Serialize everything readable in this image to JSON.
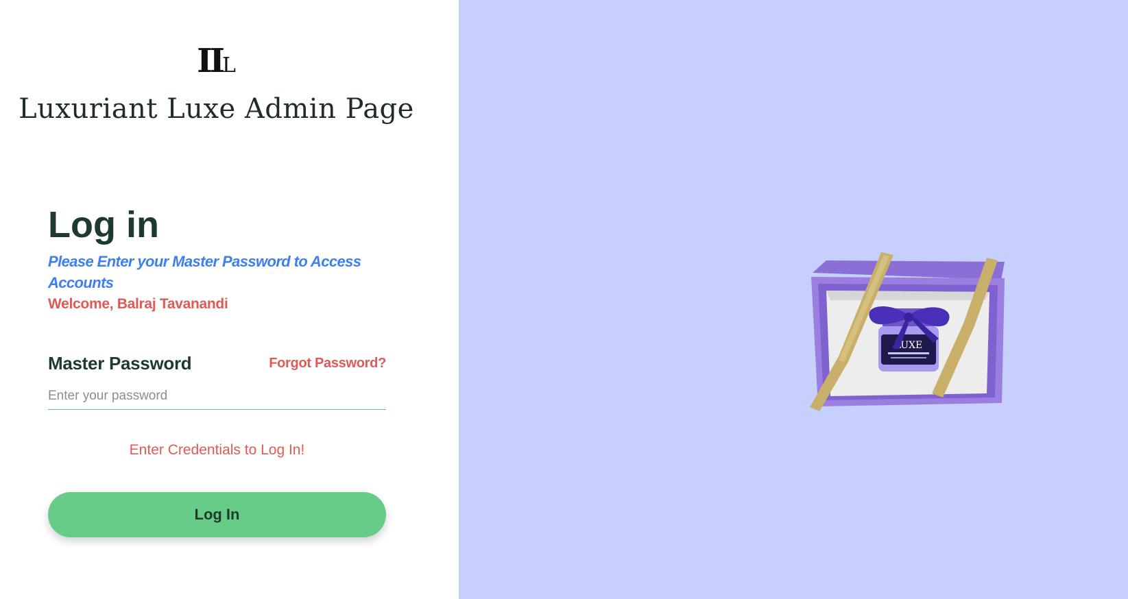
{
  "brand": {
    "logo_text": "IL",
    "title": "Luxuriant Luxe Admin Page"
  },
  "login": {
    "heading": "Log in",
    "subtitle": "Please Enter your Master Password to Access Accounts",
    "welcome": "Welcome, Balraj Tavanandi",
    "password_label": "Master Password",
    "forgot_password": "Forgot Password?",
    "password_placeholder": "Enter your password",
    "password_value": "",
    "status_message": "Enter Credentials to Log In!",
    "submit_label": "Log In"
  },
  "product": {
    "jar_brand": "LUXE"
  },
  "colors": {
    "right_panel_bg": "#c7cffd",
    "heading": "#1e3a30",
    "subtitle": "#3b7ff0",
    "accent_red": "#e05a55",
    "button_green": "#66cc88",
    "box_purple": "#9b7fe0",
    "ribbon_gold": "#c8b06a"
  }
}
